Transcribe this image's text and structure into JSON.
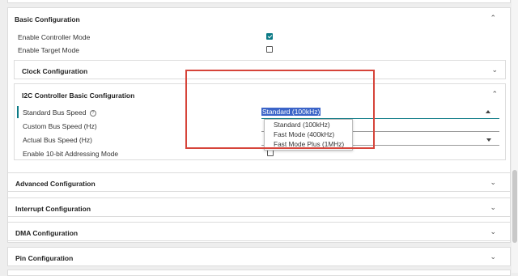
{
  "basic": {
    "title": "Basic Configuration",
    "enable_controller": "Enable Controller Mode",
    "enable_target": "Enable Target Mode"
  },
  "clock": {
    "title": "Clock Configuration"
  },
  "i2c": {
    "title": "I2C Controller Basic Configuration",
    "standard_bus_speed": "Standard Bus Speed",
    "custom_bus_speed": "Custom Bus Speed (Hz)",
    "actual_bus_speed": "Actual Bus Speed (Hz)",
    "enable_10bit": "Enable 10-bit Addressing Mode",
    "selected_value": "Standard (100kHz)",
    "options": [
      "Standard (100kHz)",
      "Fast Mode (400kHz)",
      "Fast Mode Plus (1MHz)"
    ]
  },
  "sections": {
    "advanced": "Advanced Configuration",
    "interrupt": "Interrupt Configuration",
    "dma": "DMA Configuration",
    "pin": "Pin Configuration"
  },
  "colors": {
    "accent": "#0b7a86",
    "highlight": "#d6443a",
    "selection": "#3b64c8"
  }
}
